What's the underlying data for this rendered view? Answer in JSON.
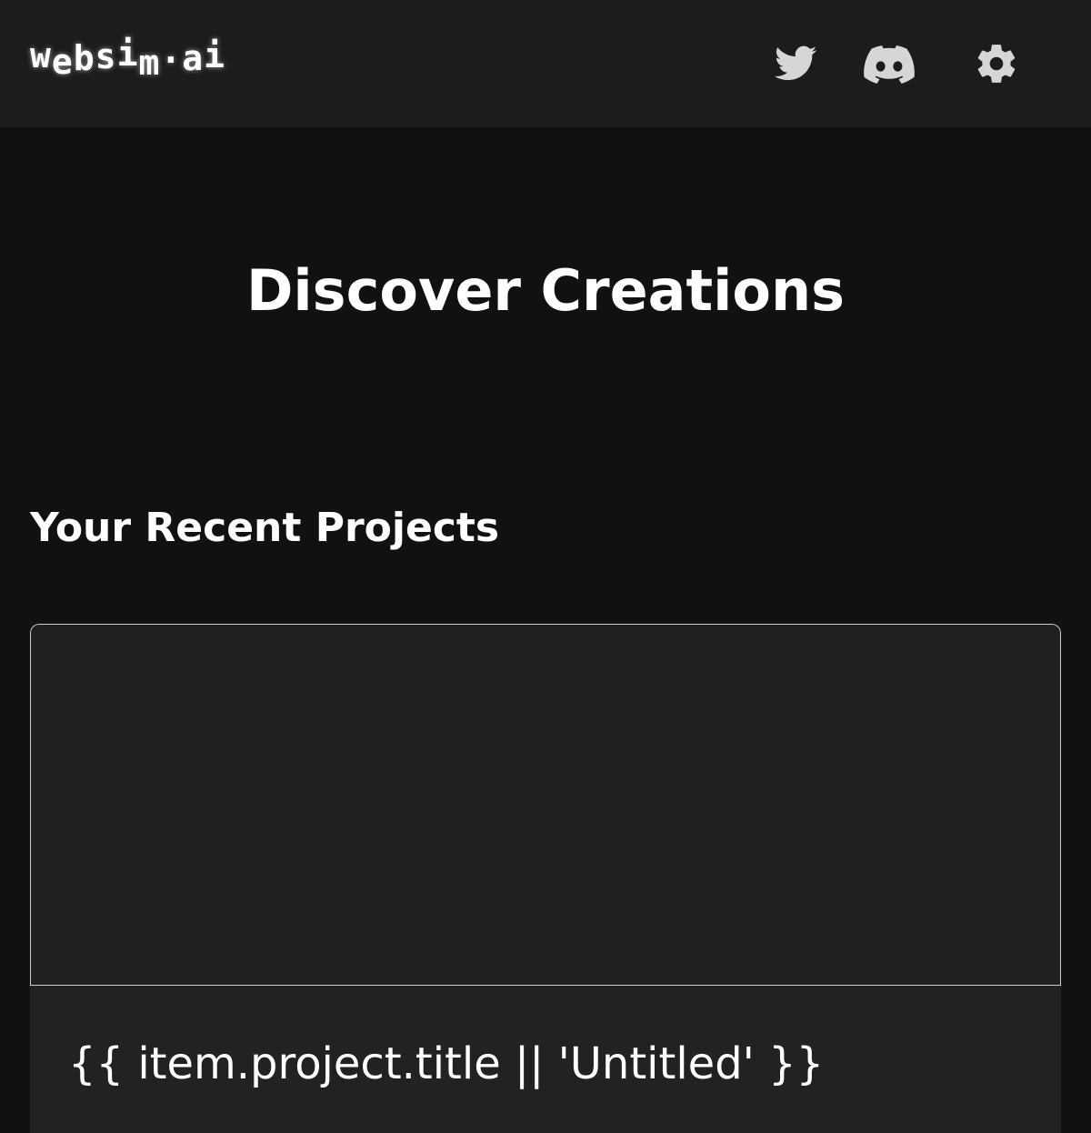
{
  "header": {
    "logo_letters": [
      "w",
      "e",
      "b",
      "s",
      "i",
      "m",
      "·",
      "a",
      "i"
    ],
    "twitter_icon": "twitter-bird-icon",
    "discord_icon": "discord-icon",
    "settings_icon": "gear-icon"
  },
  "main": {
    "title": "Discover Creations",
    "recent_heading": "Your Recent Projects",
    "projects": [
      {
        "title": "{{ item.project.title || 'Untitled' }}"
      }
    ]
  },
  "colors": {
    "page_background": "#111111",
    "header_background": "#1c1c1c",
    "card_background": "#222222",
    "icon_color": "#d6d6d6",
    "text": "#ffffff"
  }
}
